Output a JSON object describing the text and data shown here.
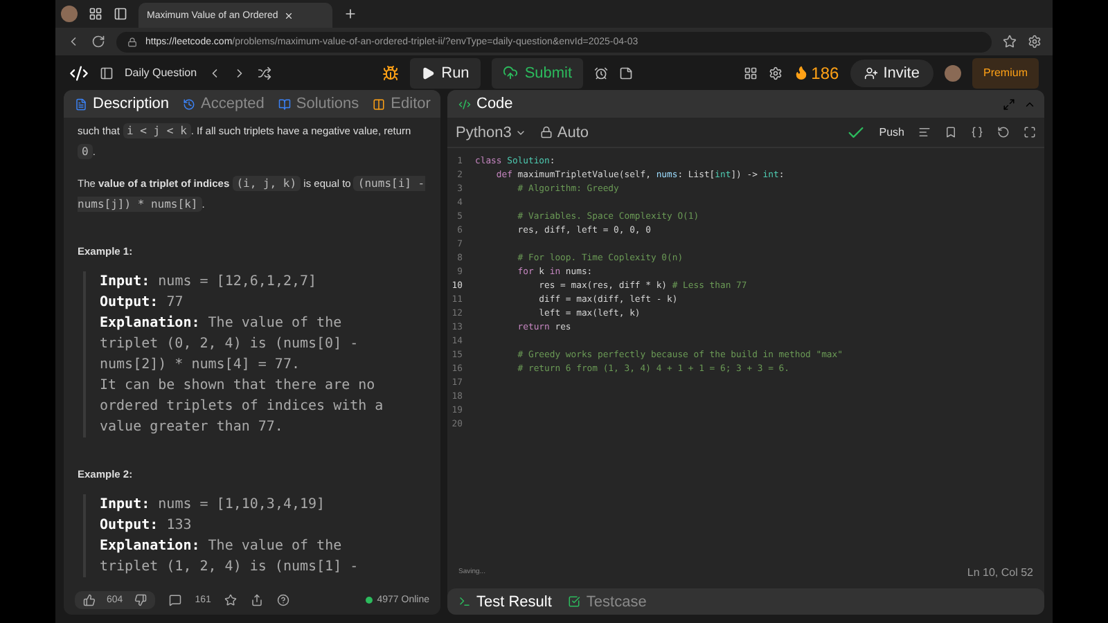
{
  "browser": {
    "tab_title": "Maximum Value of an Ordered",
    "url_host": "https://leetcode.com",
    "url_path": "/problems/maximum-value-of-an-ordered-triplet-ii/?envType=daily-question&envId=2025-04-03"
  },
  "header": {
    "daily_label": "Daily Question",
    "run_label": "Run",
    "submit_label": "Submit",
    "streak": "186",
    "invite_label": "Invite",
    "premium_label": "Premium"
  },
  "left_tabs": [
    {
      "label": "Description",
      "selected": true
    },
    {
      "label": "Accepted",
      "selected": false
    },
    {
      "label": "Solutions",
      "selected": false
    },
    {
      "label": "Editor",
      "selected": false
    }
  ],
  "description": [
    {
      "kind": "para",
      "parts": [
        {
          "kind": "text",
          "text": "such that "
        },
        {
          "kind": "code",
          "text": "i < j < k"
        },
        {
          "kind": "text",
          "text": ". If all such triplets have a negative value, return "
        },
        {
          "kind": "code",
          "text": "0"
        },
        {
          "kind": "text",
          "text": "."
        }
      ]
    },
    {
      "kind": "para",
      "parts": [
        {
          "kind": "text",
          "text": "The "
        },
        {
          "kind": "bold",
          "text": "value of a triplet of indices "
        },
        {
          "kind": "code",
          "text": "(i, j, k)"
        },
        {
          "kind": "text",
          "text": " is equal to "
        },
        {
          "kind": "code",
          "text": "(nums[i] - nums[j]) * nums[k]"
        },
        {
          "kind": "text",
          "text": "."
        }
      ]
    },
    {
      "kind": "heading",
      "text": "Example 1:"
    },
    {
      "kind": "example",
      "rows": [
        {
          "label": "Input:",
          "value": "nums = [12,6,1,2,7]"
        },
        {
          "label": "Output:",
          "value": "77"
        },
        {
          "label": "Explanation:",
          "value": "The value of the triplet (0, 2, 4) is (nums[0] - nums[2]) * nums[4] = 77.\nIt can be shown that there are no ordered triplets of indices with a value greater than 77."
        }
      ]
    },
    {
      "kind": "heading",
      "text": "Example 2:"
    },
    {
      "kind": "example",
      "rows": [
        {
          "label": "Input:",
          "value": "nums = [1,10,3,4,19]"
        },
        {
          "label": "Output:",
          "value": "133"
        },
        {
          "label": "Explanation:",
          "value": "The value of the triplet (1, 2, 4) is (nums[1] -"
        }
      ]
    }
  ],
  "left_footer": {
    "likes": "604",
    "comments": "161",
    "online": "4977 Online"
  },
  "code_panel": {
    "title": "Code",
    "language": "Python3",
    "mode": "Auto",
    "push_label": "Push",
    "status": "Saving...",
    "cursor": "Ln 10, Col 52"
  },
  "code_lines": [
    {
      "number": "1",
      "current": false,
      "tokens": [
        {
          "kind": "keyword",
          "text": "class "
        },
        {
          "kind": "type",
          "text": "Solution"
        },
        {
          "kind": "plain",
          "text": ":"
        }
      ]
    },
    {
      "number": "2",
      "current": false,
      "tokens": [
        {
          "kind": "keyword",
          "text": "    def "
        },
        {
          "kind": "plain",
          "text": "maximumTripletValue(self, "
        },
        {
          "kind": "param",
          "text": "nums"
        },
        {
          "kind": "plain",
          "text": ": List["
        },
        {
          "kind": "type",
          "text": "int"
        },
        {
          "kind": "plain",
          "text": "]) -> "
        },
        {
          "kind": "type",
          "text": "int"
        },
        {
          "kind": "plain",
          "text": ":"
        }
      ]
    },
    {
      "number": "3",
      "current": false,
      "tokens": [
        {
          "kind": "comment",
          "text": "        # Algorithm: Greedy"
        }
      ]
    },
    {
      "number": "4",
      "current": false
    },
    {
      "number": "5",
      "current": false,
      "tokens": [
        {
          "kind": "comment",
          "text": "        # Variables. Space Complexity O(1)"
        }
      ]
    },
    {
      "number": "6",
      "current": false,
      "tokens": [
        {
          "kind": "plain",
          "text": "        res, diff, left = 0, 0, 0"
        }
      ]
    },
    {
      "number": "7",
      "current": false
    },
    {
      "number": "8",
      "current": false,
      "tokens": [
        {
          "kind": "comment",
          "text": "        # For loop. Time Coplexity 0(n)"
        }
      ]
    },
    {
      "number": "9",
      "current": false,
      "tokens": [
        {
          "kind": "keyword",
          "text": "        for "
        },
        {
          "kind": "plain",
          "text": "k "
        },
        {
          "kind": "keyword",
          "text": "in "
        },
        {
          "kind": "plain",
          "text": "nums:"
        }
      ]
    },
    {
      "number": "10",
      "current": true,
      "tokens": [
        {
          "kind": "plain",
          "text": "            res = max(res, diff * k) "
        },
        {
          "kind": "comment",
          "text": "# Less than 77"
        }
      ]
    },
    {
      "number": "11",
      "current": false,
      "tokens": [
        {
          "kind": "plain",
          "text": "            diff = max(diff, left - k)"
        }
      ]
    },
    {
      "number": "12",
      "current": false,
      "tokens": [
        {
          "kind": "plain",
          "text": "            left = max(left, k)"
        }
      ]
    },
    {
      "number": "13",
      "current": false,
      "tokens": [
        {
          "kind": "keyword",
          "text": "        return "
        },
        {
          "kind": "plain",
          "text": "res"
        }
      ]
    },
    {
      "number": "14",
      "current": false
    },
    {
      "number": "15",
      "current": false,
      "tokens": [
        {
          "kind": "comment",
          "text": "        # Greedy works perfectly because of the build in method \"max\""
        }
      ]
    },
    {
      "number": "16",
      "current": false,
      "tokens": [
        {
          "kind": "comment",
          "text": "        # return 6 from (1, 3, 4) 4 + 1 + 1 = 6; 3 + 3 = 6."
        }
      ]
    },
    {
      "number": "17",
      "current": false
    },
    {
      "number": "18",
      "current": false
    },
    {
      "number": "19",
      "current": false
    },
    {
      "number": "20",
      "current": false
    }
  ],
  "bottom_tabs": [
    {
      "label": "Test Result",
      "selected": true
    },
    {
      "label": "Testcase",
      "selected": false
    }
  ]
}
